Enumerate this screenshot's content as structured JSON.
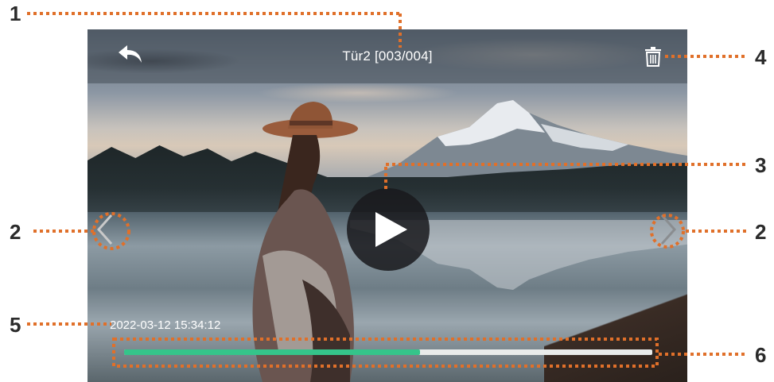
{
  "header": {
    "title": "Tür2 [003/004]"
  },
  "recording": {
    "timestamp": "2022-03-12 15:34:12"
  },
  "playback": {
    "progress_fraction": 0.56
  },
  "icons": {
    "back": "back-arrow-icon",
    "delete": "trash-icon",
    "previous": "chevron-left-icon",
    "next": "chevron-right-icon",
    "play": "play-icon"
  },
  "colors": {
    "progress_fill": "#35c48a",
    "progress_track": "#e9ebea",
    "callout": "#e0702a"
  },
  "callouts": {
    "title": "1",
    "nav_left": "2",
    "nav_right": "2",
    "play": "3",
    "delete": "4",
    "timestamp": "5",
    "progress": "6"
  }
}
